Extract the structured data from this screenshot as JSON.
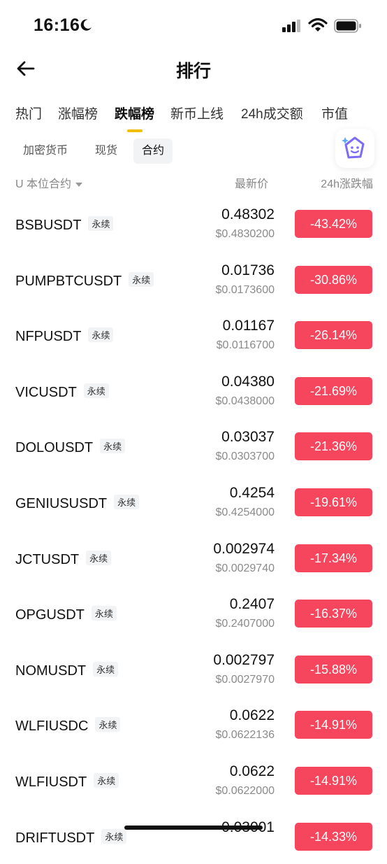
{
  "status_bar": {
    "time": "16:16"
  },
  "nav": {
    "title": "排行"
  },
  "tabs": [
    {
      "label": "热门"
    },
    {
      "label": "涨幅榜"
    },
    {
      "label": "跌幅榜"
    },
    {
      "label": "新币上线"
    },
    {
      "label": "24h成交额"
    },
    {
      "label": "市值"
    }
  ],
  "active_tab": "跌幅榜",
  "subtabs": [
    {
      "label": "加密货币"
    },
    {
      "label": "现货"
    },
    {
      "label": "合约"
    }
  ],
  "active_subtab": "合约",
  "list_header": {
    "left": "U 本位合约",
    "middle": "最新价",
    "right": "24h涨跌幅"
  },
  "rows": [
    {
      "symbol": "BSBUSDT",
      "tag": "永续",
      "price": "0.48302",
      "usd": "$0.4830200",
      "change": "-43.42%"
    },
    {
      "symbol": "PUMPBTCUSDT",
      "tag": "永续",
      "price": "0.01736",
      "usd": "$0.0173600",
      "change": "-30.86%"
    },
    {
      "symbol": "NFPUSDT",
      "tag": "永续",
      "price": "0.01167",
      "usd": "$0.0116700",
      "change": "-26.14%"
    },
    {
      "symbol": "VICUSDT",
      "tag": "永续",
      "price": "0.04380",
      "usd": "$0.0438000",
      "change": "-21.69%"
    },
    {
      "symbol": "DOLOUSDT",
      "tag": "永续",
      "price": "0.03037",
      "usd": "$0.0303700",
      "change": "-21.36%"
    },
    {
      "symbol": "GENIUSUSDT",
      "tag": "永续",
      "price": "0.4254",
      "usd": "$0.4254000",
      "change": "-19.61%"
    },
    {
      "symbol": "JCTUSDT",
      "tag": "永续",
      "price": "0.002974",
      "usd": "$0.0029740",
      "change": "-17.34%"
    },
    {
      "symbol": "OPGUSDT",
      "tag": "永续",
      "price": "0.2407",
      "usd": "$0.2407000",
      "change": "-16.37%"
    },
    {
      "symbol": "NOMUSDT",
      "tag": "永续",
      "price": "0.002797",
      "usd": "$0.0027970",
      "change": "-15.88%"
    },
    {
      "symbol": "WLFIUSDC",
      "tag": "永续",
      "price": "0.0622",
      "usd": "$0.0622136",
      "change": "-14.91%"
    },
    {
      "symbol": "WLFIUSDT",
      "tag": "永续",
      "price": "0.0622",
      "usd": "$0.0622000",
      "change": "-14.91%"
    },
    {
      "symbol": "DRIFTUSDT",
      "tag": "永续",
      "price": "0.03001",
      "usd": "",
      "change": "-14.33%"
    }
  ],
  "colors": {
    "negative": "#f6465d",
    "accent": "#f0c000",
    "assistant": "#7b6cf6"
  },
  "icons": {
    "back": "arrow-left-icon",
    "dnd": "moon-icon",
    "assistant": "sparkle-assistant-icon"
  }
}
